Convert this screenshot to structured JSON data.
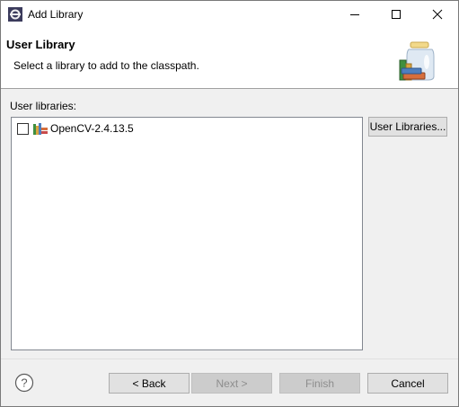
{
  "window": {
    "title": "Add Library",
    "controls": {
      "minimize": "minimize-icon",
      "maximize": "maximize-icon",
      "close": "close-icon"
    }
  },
  "banner": {
    "title": "User Library",
    "description": "Select a library to add to the classpath."
  },
  "body": {
    "libraries_label": "User libraries:",
    "libraries": [
      {
        "name": "OpenCV-2.4.13.5",
        "checked": false,
        "icon": "library-icon"
      }
    ],
    "user_libraries_button": "User Libraries..."
  },
  "footer": {
    "back": "< Back",
    "next": "Next >",
    "finish": "Finish",
    "cancel": "Cancel"
  }
}
